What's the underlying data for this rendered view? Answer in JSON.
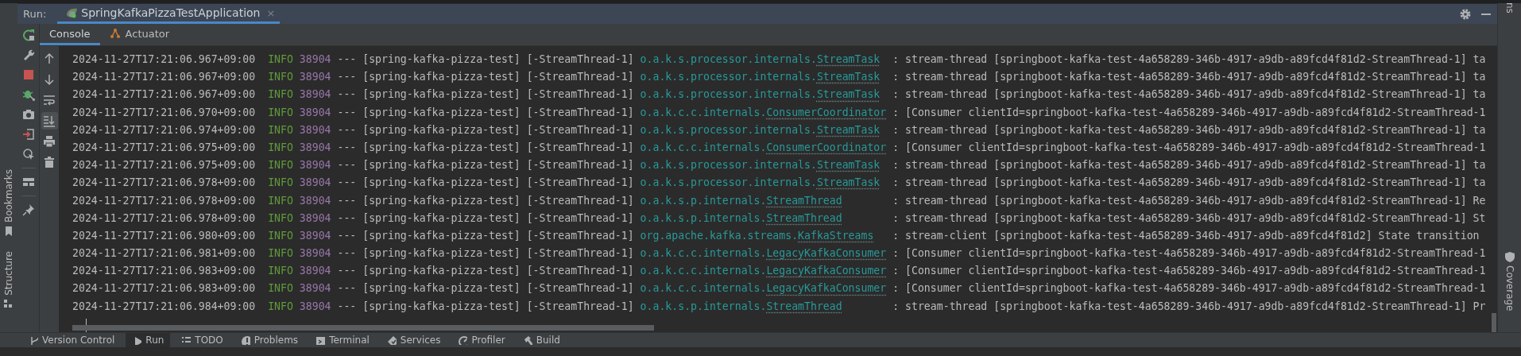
{
  "run_header": {
    "label": "Run:",
    "tab": {
      "title": "SpringKafkaPizzaTestApplication",
      "selected": true,
      "close": "×"
    }
  },
  "console_tabs": [
    {
      "label": "Console",
      "selected": true
    },
    {
      "label": "Actuator",
      "selected": false
    }
  ],
  "output_toolbar": [
    {
      "kind": "up",
      "on": false
    },
    {
      "kind": "down",
      "on": false
    },
    {
      "kind": "soft_wrap",
      "on": false
    },
    {
      "kind": "scroll_to_end",
      "on": true
    },
    {
      "kind": "print",
      "on": false
    },
    {
      "kind": "clear",
      "on": false
    }
  ],
  "log_lines": [
    {
      "time": "2024-11-27T17:21:06.967+09:00",
      "level": "INFO",
      "pid": "38904",
      "separator": "---",
      "app": "[spring-kafka-pizza-test]",
      "thread": "[-StreamThread-1]",
      "logger_package": "o.a.k.s.processor.internals.",
      "logger_class": "StreamTask",
      "message": ": stream-thread [springboot-kafka-test-4a658289-346b-4917-a9db-a89fcd4f81d2-StreamThread-1] ta"
    },
    {
      "time": "2024-11-27T17:21:06.967+09:00",
      "level": "INFO",
      "pid": "38904",
      "separator": "---",
      "app": "[spring-kafka-pizza-test]",
      "thread": "[-StreamThread-1]",
      "logger_package": "o.a.k.s.processor.internals.",
      "logger_class": "StreamTask",
      "message": ": stream-thread [springboot-kafka-test-4a658289-346b-4917-a9db-a89fcd4f81d2-StreamThread-1] ta"
    },
    {
      "time": "2024-11-27T17:21:06.967+09:00",
      "level": "INFO",
      "pid": "38904",
      "separator": "---",
      "app": "[spring-kafka-pizza-test]",
      "thread": "[-StreamThread-1]",
      "logger_package": "o.a.k.s.processor.internals.",
      "logger_class": "StreamTask",
      "message": ": stream-thread [springboot-kafka-test-4a658289-346b-4917-a9db-a89fcd4f81d2-StreamThread-1] ta"
    },
    {
      "time": "2024-11-27T17:21:06.970+09:00",
      "level": "INFO",
      "pid": "38904",
      "separator": "---",
      "app": "[spring-kafka-pizza-test]",
      "thread": "[-StreamThread-1]",
      "logger_package": "o.a.k.c.c.internals.",
      "logger_class": "ConsumerCoordinator",
      "message": ": [Consumer clientId=springboot-kafka-test-4a658289-346b-4917-a9db-a89fcd4f81d2-StreamThread-1"
    },
    {
      "time": "2024-11-27T17:21:06.974+09:00",
      "level": "INFO",
      "pid": "38904",
      "separator": "---",
      "app": "[spring-kafka-pizza-test]",
      "thread": "[-StreamThread-1]",
      "logger_package": "o.a.k.s.processor.internals.",
      "logger_class": "StreamTask",
      "message": ": stream-thread [springboot-kafka-test-4a658289-346b-4917-a9db-a89fcd4f81d2-StreamThread-1] ta"
    },
    {
      "time": "2024-11-27T17:21:06.975+09:00",
      "level": "INFO",
      "pid": "38904",
      "separator": "---",
      "app": "[spring-kafka-pizza-test]",
      "thread": "[-StreamThread-1]",
      "logger_package": "o.a.k.c.c.internals.",
      "logger_class": "ConsumerCoordinator",
      "message": ": [Consumer clientId=springboot-kafka-test-4a658289-346b-4917-a9db-a89fcd4f81d2-StreamThread-1"
    },
    {
      "time": "2024-11-27T17:21:06.975+09:00",
      "level": "INFO",
      "pid": "38904",
      "separator": "---",
      "app": "[spring-kafka-pizza-test]",
      "thread": "[-StreamThread-1]",
      "logger_package": "o.a.k.s.processor.internals.",
      "logger_class": "StreamTask",
      "message": ": stream-thread [springboot-kafka-test-4a658289-346b-4917-a9db-a89fcd4f81d2-StreamThread-1] ta"
    },
    {
      "time": "2024-11-27T17:21:06.978+09:00",
      "level": "INFO",
      "pid": "38904",
      "separator": "---",
      "app": "[spring-kafka-pizza-test]",
      "thread": "[-StreamThread-1]",
      "logger_package": "o.a.k.s.processor.internals.",
      "logger_class": "StreamTask",
      "message": ": stream-thread [springboot-kafka-test-4a658289-346b-4917-a9db-a89fcd4f81d2-StreamThread-1] ta"
    },
    {
      "time": "2024-11-27T17:21:06.978+09:00",
      "level": "INFO",
      "pid": "38904",
      "separator": "---",
      "app": "[spring-kafka-pizza-test]",
      "thread": "[-StreamThread-1]",
      "logger_package": "o.a.k.s.p.internals.",
      "logger_class": "StreamThread",
      "message": ": stream-thread [springboot-kafka-test-4a658289-346b-4917-a9db-a89fcd4f81d2-StreamThread-1] Re"
    },
    {
      "time": "2024-11-27T17:21:06.978+09:00",
      "level": "INFO",
      "pid": "38904",
      "separator": "---",
      "app": "[spring-kafka-pizza-test]",
      "thread": "[-StreamThread-1]",
      "logger_package": "o.a.k.s.p.internals.",
      "logger_class": "StreamThread",
      "message": ": stream-thread [springboot-kafka-test-4a658289-346b-4917-a9db-a89fcd4f81d2-StreamThread-1] St"
    },
    {
      "time": "2024-11-27T17:21:06.980+09:00",
      "level": "INFO",
      "pid": "38904",
      "separator": "---",
      "app": "[spring-kafka-pizza-test]",
      "thread": "[-StreamThread-1]",
      "logger_package": "org.apache.kafka.streams.",
      "logger_class": "KafkaStreams",
      "message": ": stream-client [springboot-kafka-test-4a658289-346b-4917-a9db-a89fcd4f81d2] State transition"
    },
    {
      "time": "2024-11-27T17:21:06.981+09:00",
      "level": "INFO",
      "pid": "38904",
      "separator": "---",
      "app": "[spring-kafka-pizza-test]",
      "thread": "[-StreamThread-1]",
      "logger_package": "o.a.k.c.c.internals.",
      "logger_class": "LegacyKafkaConsumer",
      "message": ": [Consumer clientId=springboot-kafka-test-4a658289-346b-4917-a9db-a89fcd4f81d2-StreamThread-1"
    },
    {
      "time": "2024-11-27T17:21:06.983+09:00",
      "level": "INFO",
      "pid": "38904",
      "separator": "---",
      "app": "[spring-kafka-pizza-test]",
      "thread": "[-StreamThread-1]",
      "logger_package": "o.a.k.c.c.internals.",
      "logger_class": "LegacyKafkaConsumer",
      "message": ": [Consumer clientId=springboot-kafka-test-4a658289-346b-4917-a9db-a89fcd4f81d2-StreamThread-1"
    },
    {
      "time": "2024-11-27T17:21:06.983+09:00",
      "level": "INFO",
      "pid": "38904",
      "separator": "---",
      "app": "[spring-kafka-pizza-test]",
      "thread": "[-StreamThread-1]",
      "logger_package": "o.a.k.c.c.internals.",
      "logger_class": "LegacyKafkaConsumer",
      "message": ": [Consumer clientId=springboot-kafka-test-4a658289-346b-4917-a9db-a89fcd4f81d2-StreamThread-1"
    },
    {
      "time": "2024-11-27T17:21:06.984+09:00",
      "level": "INFO",
      "pid": "38904",
      "separator": "---",
      "app": "[spring-kafka-pizza-test]",
      "thread": "[-StreamThread-1]",
      "logger_package": "o.a.k.s.p.internals.",
      "logger_class": "StreamThread",
      "message": ": stream-thread [springboot-kafka-test-4a658289-346b-4917-a9db-a89fcd4f81d2-StreamThread-1] Pr"
    }
  ],
  "left_strip": [
    {
      "label": "Bookmarks",
      "kind": "bookmarks"
    },
    {
      "label": "Structure",
      "kind": "structure"
    }
  ],
  "right_strip": [
    {
      "label": "ns",
      "kind": "plain"
    },
    {
      "label": "Coverage",
      "kind": "coverage"
    }
  ],
  "bottom_tabs": [
    {
      "label": "Version Control",
      "kind": "vcs",
      "selected": false
    },
    {
      "label": "Run",
      "kind": "run",
      "selected": true
    },
    {
      "label": "TODO",
      "kind": "todo",
      "selected": false
    },
    {
      "label": "Problems",
      "kind": "problems",
      "selected": false
    },
    {
      "label": "Terminal",
      "kind": "terminal",
      "selected": false
    },
    {
      "label": "Services",
      "kind": "services",
      "selected": false
    },
    {
      "label": "Profiler",
      "kind": "profiler",
      "selected": false
    },
    {
      "label": "Build",
      "kind": "build",
      "selected": false
    }
  ]
}
